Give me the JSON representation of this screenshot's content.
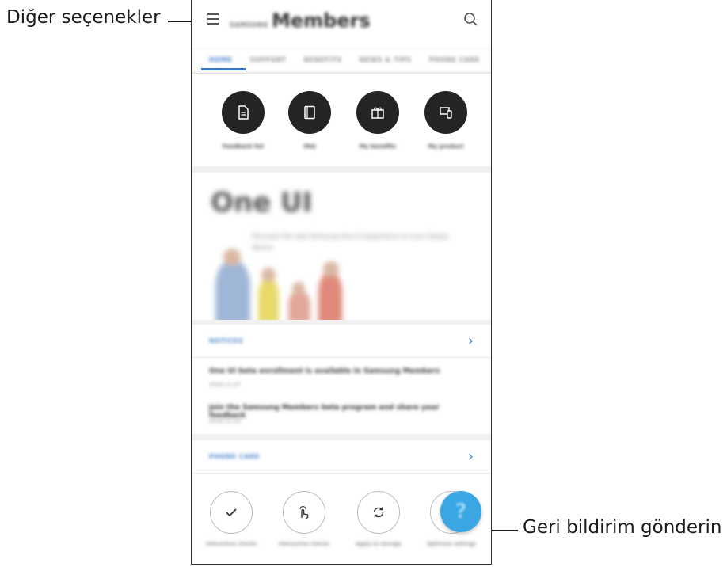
{
  "callouts": {
    "more_options": "Diğer seçenekler",
    "send_feedback": "Geri bildirim gönderin"
  },
  "app": {
    "brand": "SAMSUNG",
    "title": "Members"
  },
  "tabs": [
    "HOME",
    "SUPPORT",
    "BENEFITS",
    "NEWS & TIPS",
    "PHONE CARE"
  ],
  "quick_actions": [
    {
      "label": "Feedback list",
      "icon": "document-icon"
    },
    {
      "label": "FAQ",
      "icon": "book-icon"
    },
    {
      "label": "My benefits",
      "icon": "gift-icon"
    },
    {
      "label": "My product",
      "icon": "devices-icon"
    }
  ],
  "hero": {
    "title": "One UI",
    "text": "Discover the new Samsung One UI experience on your Galaxy device"
  },
  "notices": {
    "header": "NOTICES",
    "items": [
      {
        "title": "One UI beta enrollment is available in Samsung Members",
        "date": "2018.11.07"
      },
      {
        "title": "Join the Samsung Members beta program and share your feedback",
        "date": "2018.11.02"
      }
    ]
  },
  "phone_care": {
    "header": "PHONE CARE",
    "items": [
      {
        "label": "Interactive checks",
        "icon": "check-icon"
      },
      {
        "label": "Interactive checks",
        "icon": "touch-icon"
      },
      {
        "label": "Apply to storage",
        "icon": "refresh-icon"
      },
      {
        "label": "Optimize settings",
        "icon": "gear-icon"
      }
    ]
  },
  "fab": {
    "glyph": "?",
    "icon": "feedback-icon"
  },
  "colors": {
    "accent": "#3b74c9",
    "fab": "#3aa7e2",
    "dark_circle": "#242424"
  }
}
